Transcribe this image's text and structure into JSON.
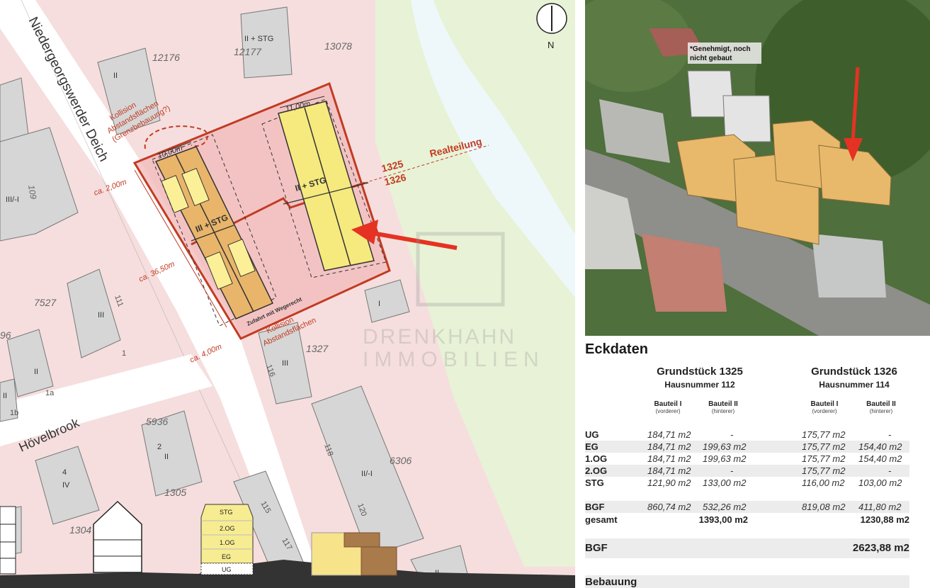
{
  "map": {
    "streets": [
      "Niedergeorgswerder Deich",
      "Hövelbrook"
    ],
    "parcel_numbers": [
      "12176",
      "12177",
      "13078",
      "109",
      "7527",
      "1327",
      "5936",
      "1305",
      "6306",
      "1304",
      "96"
    ],
    "house_numbers": [
      "111",
      "116",
      "1a",
      "1b",
      "118",
      "115",
      "117",
      "120",
      "1"
    ],
    "storeys": [
      "II + STG",
      "II",
      "III/-I",
      "III",
      "I",
      "2",
      "II",
      "4",
      "IV",
      "II/-I",
      "II",
      "II",
      "III",
      "II"
    ],
    "building_labels": {
      "front": "III + STG",
      "rear": "II + STG"
    },
    "dimensions": {
      "width_front": "10,00m",
      "width_rear": "11,00m",
      "dist_2": "ca. 2,00m",
      "length": "ca. 36,50m",
      "dist_4": "ca. 4,00m"
    },
    "annotations": {
      "kollision1_line1": "Kollision",
      "kollision1_line2": "Abstandsflächen",
      "kollision1_line3": "(Grenzbebauung?)",
      "kollision2_line1": "Kollision",
      "kollision2_line2": "Abstandsflächen",
      "access": "Zufahrt mit Wegerecht",
      "realteilung": "Realteilung",
      "plot_a": "1325",
      "plot_b": "1326"
    },
    "north": "N",
    "watermark_line1": "DRENKHAHN",
    "watermark_line2": "IMMOBILIEN",
    "section_floors": [
      "STG",
      "2.OG",
      "1.OG",
      "EG",
      "UG"
    ]
  },
  "aerial": {
    "note_line1": "*Genehmigt, noch",
    "note_line2": "nicht gebaut"
  },
  "eckdaten": {
    "title": "Eckdaten",
    "grundstueck": [
      {
        "name": "Grundstück 1325",
        "haus": "Hausnummer 112"
      },
      {
        "name": "Grundstück 1326",
        "haus": "Hausnummer 114"
      }
    ],
    "bauteile": [
      {
        "label": "Bauteil I",
        "sub": "(vorderer)"
      },
      {
        "label": "Bauteil II",
        "sub": "(hinterer)"
      },
      {
        "label": "Bauteil I",
        "sub": "(vorderer)"
      },
      {
        "label": "Bauteil II",
        "sub": "(hinterer)"
      }
    ],
    "rows": [
      {
        "k": "UG",
        "v": [
          "184,71 m2",
          "-",
          "175,77 m2",
          "-"
        ]
      },
      {
        "k": "EG",
        "v": [
          "184,71 m2",
          "199,63 m2",
          "175,77 m2",
          "154,40 m2"
        ]
      },
      {
        "k": "1.OG",
        "v": [
          "184,71 m2",
          "199,63 m2",
          "175,77 m2",
          "154,40 m2"
        ]
      },
      {
        "k": "2.OG",
        "v": [
          "184,71 m2",
          "-",
          "175,77 m2",
          "-"
        ]
      },
      {
        "k": "STG",
        "v": [
          "121,90 m2",
          "133,00 m2",
          "116,00 m2",
          "103,00 m2"
        ]
      }
    ],
    "bgf_row": {
      "k": "BGF",
      "v": [
        "860,74 m2",
        "532,26 m2",
        "819,08 m2",
        "411,80 m2"
      ]
    },
    "gesamt_row": {
      "k": "gesamt",
      "t1": "1393,00 m2",
      "t2": "1230,88 m2"
    },
    "bgf_total": {
      "k": "BGF",
      "v": "2623,88 m2"
    },
    "bebauung": "Bebauung"
  }
}
